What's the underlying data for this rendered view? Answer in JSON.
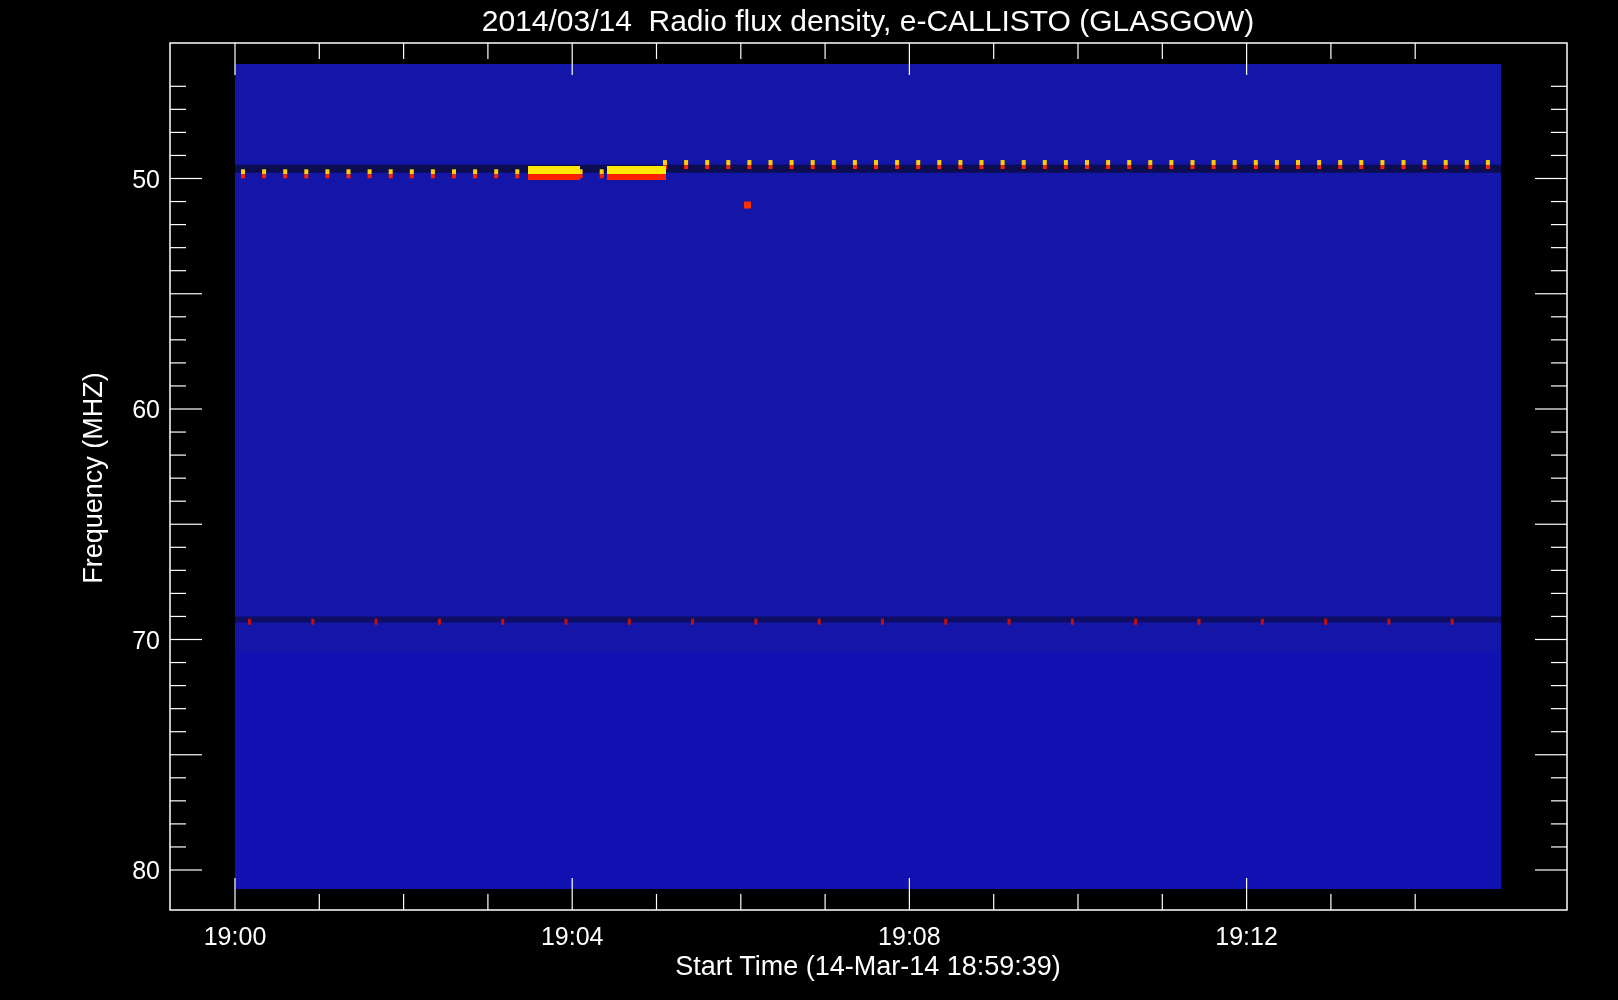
{
  "title": "2014/03/14  Radio flux density, e-CALLISTO (GLASGOW)",
  "ylabel": "Frequency (MHZ)",
  "xlabel": "Start Time (14-Mar-14 18:59:39)",
  "yticks": [
    "50",
    "60",
    "70",
    "80"
  ],
  "xticks": [
    "19:00",
    "19:04",
    "19:08",
    "19:12"
  ]
}
